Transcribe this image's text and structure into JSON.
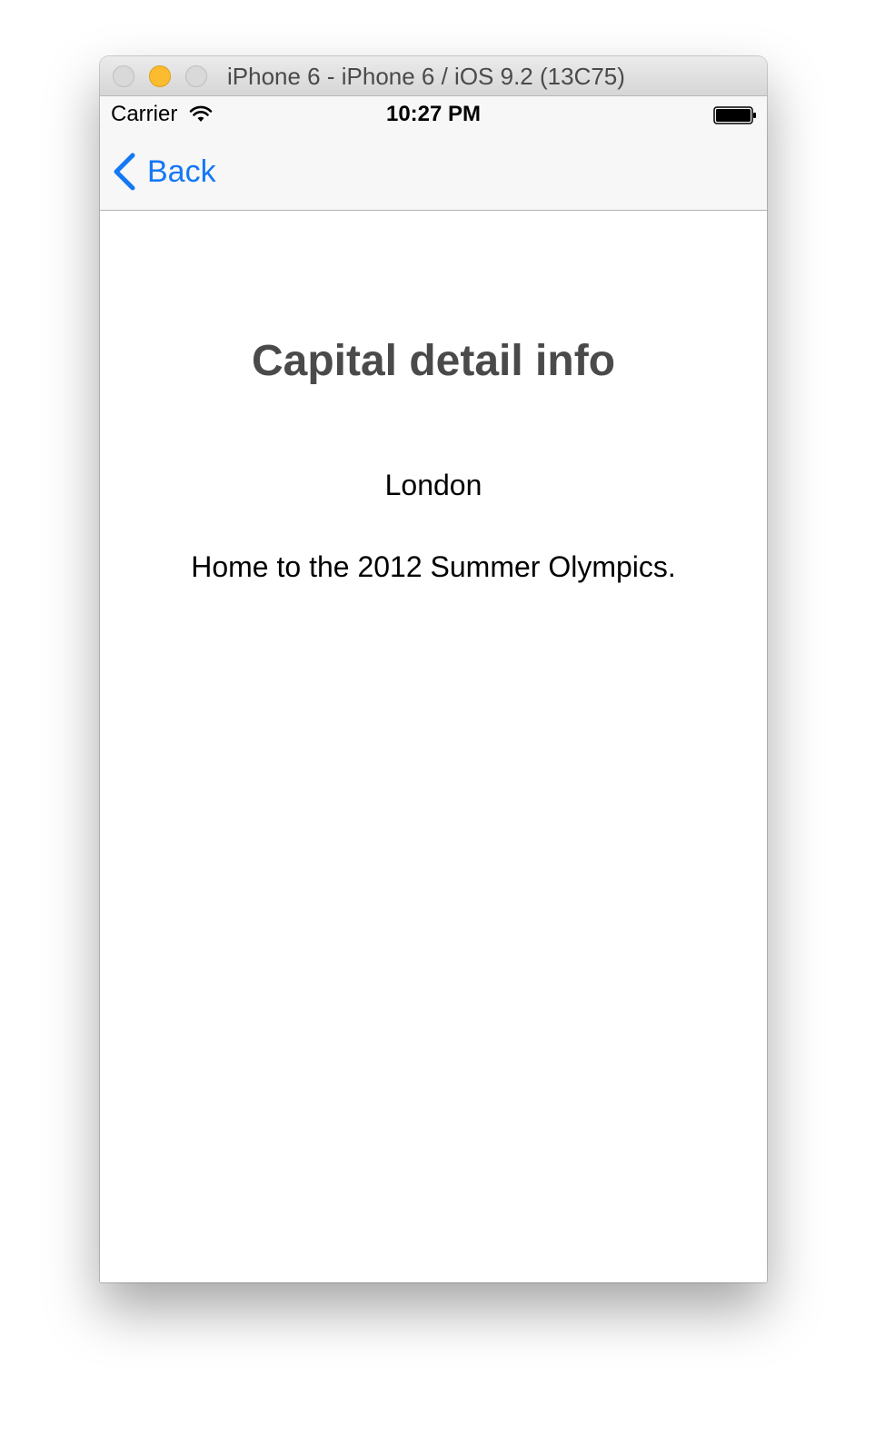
{
  "window": {
    "title": "iPhone 6 - iPhone 6 / iOS 9.2 (13C75)"
  },
  "status_bar": {
    "carrier": "Carrier",
    "time": "10:27 PM",
    "wifi_icon": "wifi-icon",
    "battery_icon": "battery-icon"
  },
  "nav_bar": {
    "back_label": "Back",
    "back_icon": "chevron-left-icon",
    "accent_color": "#1478F5"
  },
  "main": {
    "title": "Capital detail info",
    "city": "London",
    "description": "Home to the 2012 Summer Olympics."
  }
}
